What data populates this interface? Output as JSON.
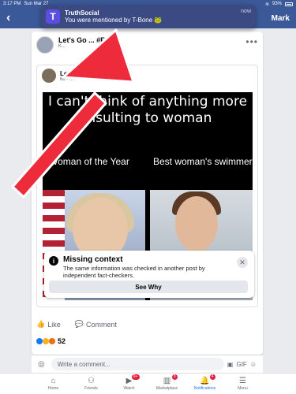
{
  "status_bar": {
    "time": "3:17 PM",
    "date": "Sun Mar 27",
    "battery": "93%"
  },
  "top_nav": {
    "user_name": "Mark"
  },
  "notification": {
    "app_name": "TruthSocial",
    "message": "You were mentioned by T-Bone 🐸",
    "time": "now"
  },
  "post": {
    "title": "Let's Go ... #FJB",
    "subtitle": "K..."
  },
  "shared_post": {
    "author": "Lopez",
    "time": "6d · ..."
  },
  "meme": {
    "headline": "I can't think of anything more insulting to woman",
    "caption_left": "Woman of the Year",
    "caption_right": "Best woman's swimmer"
  },
  "fact_check": {
    "title": "Missing context",
    "body": "The same information was checked in another post by independent fact-checkers.",
    "button": "See Why"
  },
  "actions": {
    "like": "Like",
    "comment": "Comment"
  },
  "reactions": {
    "count": "52"
  },
  "comment_bar": {
    "placeholder": "Write a comment...",
    "gif": "GIF"
  },
  "tabs": [
    {
      "label": "Home",
      "badge": ""
    },
    {
      "label": "Friends",
      "badge": ""
    },
    {
      "label": "Watch",
      "badge": "9+"
    },
    {
      "label": "Marketplace",
      "badge": "3"
    },
    {
      "label": "Notifications",
      "badge": "4"
    },
    {
      "label": "Menu",
      "badge": ""
    }
  ],
  "colors": {
    "brand": "#3b5998",
    "notif_bg": "#3c4a83",
    "arrow": "#ee2b3b",
    "active_tab": "#1877f2"
  }
}
